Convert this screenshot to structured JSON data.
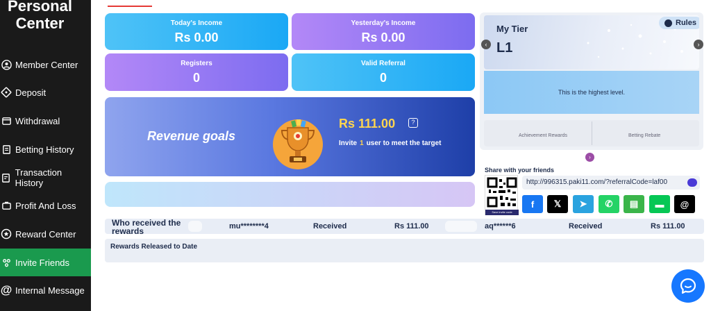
{
  "sidebar": {
    "title": "Personal Center",
    "items": [
      {
        "label": "Member Center",
        "icon": "person-icon"
      },
      {
        "label": "Deposit",
        "icon": "deposit-icon"
      },
      {
        "label": "Withdrawal",
        "icon": "withdrawal-icon"
      },
      {
        "label": "Betting History",
        "icon": "history-icon"
      },
      {
        "label": "Transaction History",
        "icon": "transaction-icon"
      },
      {
        "label": "Profit And Loss",
        "icon": "profit-icon"
      },
      {
        "label": "Reward Center",
        "icon": "reward-icon"
      },
      {
        "label": "Invite Friends",
        "icon": "invite-icon",
        "active": true
      },
      {
        "label": "Internal Message",
        "icon": "at-icon"
      }
    ]
  },
  "stats": {
    "today_income": {
      "label": "Today's Income",
      "value": "Rs  0.00"
    },
    "yesterday_income": {
      "label": "Yesterday's Income",
      "value": "Rs  0.00"
    },
    "registers": {
      "label": "Registers",
      "value": "0"
    },
    "valid_referral": {
      "label": "Valid Referral",
      "value": "0"
    }
  },
  "goals": {
    "title": "Revenue goals",
    "amount": "Rs  111.00",
    "help": "?",
    "invite_prefix": "Invite",
    "invite_count": "1",
    "invite_suffix": "user to meet the target"
  },
  "tier": {
    "label": "My Tier",
    "level": "L1",
    "rules": "Rules",
    "message": "This is the highest level.",
    "achievement": "Achievement Rewards",
    "betting_rebate": "Betting Rebate"
  },
  "share": {
    "title": "Share with your friends",
    "link": "http://996315.paki11.com/?referralCode=laf00",
    "qr_caption": "Save invite code",
    "socials": [
      {
        "name": "facebook",
        "glyph": "f",
        "color": "#1877f2"
      },
      {
        "name": "x",
        "glyph": "𝕏",
        "color": "#000000"
      },
      {
        "name": "telegram",
        "glyph": "➤",
        "color": "#2aa3df"
      },
      {
        "name": "whatsapp",
        "glyph": "✆",
        "color": "#25d366"
      },
      {
        "name": "sms",
        "glyph": "▤",
        "color": "#3bb54a"
      },
      {
        "name": "line",
        "glyph": "▬",
        "color": "#06c755"
      },
      {
        "name": "threads",
        "glyph": "@",
        "color": "#000000"
      }
    ]
  },
  "rewards": {
    "title": "Who received the rewards",
    "entries": [
      {
        "user": "mu********4",
        "status": "Received",
        "amount": "Rs  111.00"
      },
      {
        "user": "aq******6",
        "status": "Received",
        "amount": "Rs  111.00"
      }
    ],
    "released_title": "Rewards Released to Date"
  }
}
